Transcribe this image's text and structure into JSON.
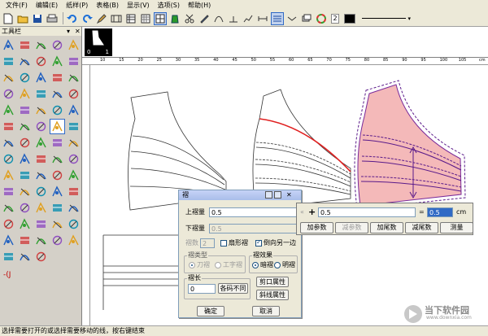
{
  "menu": [
    "文件(F)",
    "编辑(E)",
    "纸样(P)",
    "表格(B)",
    "显示(V)",
    "选项(S)",
    "帮助(H)"
  ],
  "toolbar": {
    "line_width": "2"
  },
  "toolbox": {
    "title": "工具栏",
    "pin": "▾",
    "close": "✕",
    "extra": "-(J"
  },
  "thumb": {
    "left_num": "0",
    "right_num": "1"
  },
  "ruler": {
    "h_labels": [
      "10",
      "15",
      "20",
      "25",
      "30",
      "35",
      "40",
      "45",
      "50",
      "55",
      "60",
      "65",
      "70",
      "75",
      "80",
      "85",
      "90",
      "95",
      "100",
      "105"
    ],
    "unit": "cm"
  },
  "status": "选择需要打开的或选择需要移动的线，按右键结束",
  "dialog": {
    "title": "褶",
    "upper_label": "上褶量",
    "upper_value": "0.5",
    "lower_label": "下褶量",
    "lower_value": "0.5",
    "count_label": "褶数",
    "count_value": "2",
    "fan_label": "扇形褶",
    "reverse_label": "倒向另一边",
    "type_group": "褶类型",
    "type_knife": "刀褶",
    "type_i": "工字褶",
    "effect_group": "褶效果",
    "effect_hidden": "暗褶",
    "effect_visible": "明褶",
    "length_group": "褶长",
    "length_value": "0",
    "size_diff": "各码不同",
    "notch_attr": "剪口属性",
    "line_attr": "斜线属性",
    "ok": "确定",
    "cancel": "取消"
  },
  "value_panel": {
    "expr": "0.5",
    "result": "0.5",
    "unit": "cm",
    "btn_add_ref": "加参数",
    "btn_sub_ref": "减参数",
    "btn_add_len": "加尾数",
    "btn_sub_len": "减尾数",
    "btn_measure": "测量"
  },
  "watermark": {
    "brand": "当下软件园",
    "url": "www.downxia.com"
  }
}
